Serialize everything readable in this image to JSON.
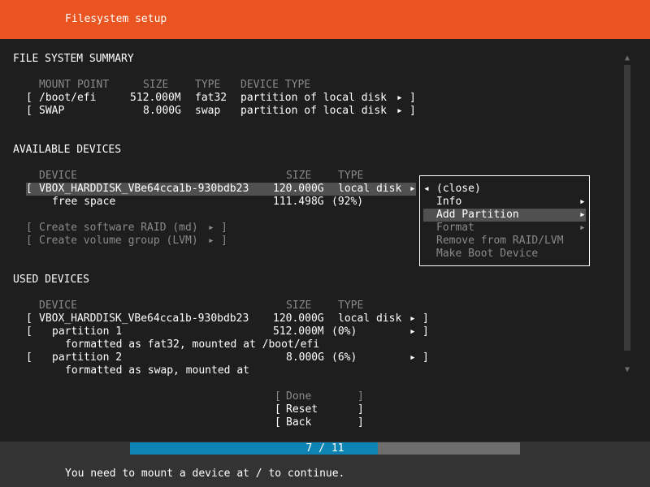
{
  "header": {
    "title": "Filesystem setup"
  },
  "fs_summary": {
    "heading": "FILE SYSTEM SUMMARY",
    "columns": {
      "mount_point": "MOUNT POINT",
      "size": "SIZE",
      "type": "TYPE",
      "device_type": "DEVICE TYPE"
    },
    "rows": [
      {
        "open": "[",
        "mount": "/boot/efi",
        "size": "512.000M",
        "type": "fat32",
        "device_type": "partition of local disk",
        "arrow": "▸",
        "close": "]"
      },
      {
        "open": "[",
        "mount": "SWAP",
        "size": "8.000G",
        "type": "swap",
        "device_type": "partition of local disk",
        "arrow": "▸",
        "close": "]"
      }
    ]
  },
  "available": {
    "heading": "AVAILABLE DEVICES",
    "columns": {
      "device": "DEVICE",
      "size": "SIZE",
      "type": "TYPE"
    },
    "disk": {
      "open": "[",
      "name": "VBOX_HARDDISK_VBe64cca1b-930bdb23",
      "size": "120.000G",
      "type": "local disk",
      "arrow": "▸"
    },
    "free": {
      "label": "free space",
      "size": "111.498G",
      "pct": "(92%)"
    },
    "actions": [
      {
        "open": "[",
        "label": "Create software RAID (md)",
        "arrow": "▸",
        "close": "]"
      },
      {
        "open": "[",
        "label": "Create volume group (LVM)",
        "arrow": "▸",
        "close": "]"
      }
    ]
  },
  "context_menu": {
    "close_arrow": "◂",
    "close": "(close)",
    "items": [
      {
        "label": "Info",
        "arrow": "▸"
      },
      {
        "label": "Add Partition",
        "arrow": "▸"
      },
      {
        "label": "Format",
        "arrow": "▸"
      },
      {
        "label": "Remove from RAID/LVM"
      },
      {
        "label": "Make Boot Device"
      }
    ]
  },
  "used": {
    "heading": "USED DEVICES",
    "columns": {
      "device": "DEVICE",
      "size": "SIZE",
      "type": "TYPE"
    },
    "disk": {
      "open": "[",
      "name": "VBOX_HARDDISK_VBe64cca1b-930bdb23",
      "size": "120.000G",
      "type": "local disk",
      "arrow": "▸",
      "close": "]"
    },
    "partitions": [
      {
        "open": "[",
        "label": "partition 1",
        "size": "512.000M",
        "pct": "(0%)",
        "arrow": "▸",
        "close": "]",
        "note": "formatted as fat32, mounted at /boot/efi"
      },
      {
        "open": "[",
        "label": "partition 2",
        "size": "8.000G",
        "pct": "(6%)",
        "arrow": "▸",
        "close": "]",
        "note": "formatted as swap, mounted at"
      }
    ]
  },
  "buttons": {
    "done": {
      "open": "[",
      "label": "Done",
      "close": "]"
    },
    "reset": {
      "open": "[",
      "label": "Reset",
      "close": "]"
    },
    "back": {
      "open": "[",
      "label": "Back",
      "close": "]"
    }
  },
  "scrollbar": {
    "up": "▲",
    "down": "▼"
  },
  "progress": {
    "label": "7 / 11",
    "current": 7,
    "total": 11
  },
  "status": "You need to mount a device at / to continue.",
  "colors": {
    "header": "#e95420",
    "background": "#1e1e1e",
    "highlight": "#505050",
    "progress_fill": "#0e84b5",
    "progress_track": "#6e6e6e",
    "dim_text": "#8a8a8a"
  }
}
